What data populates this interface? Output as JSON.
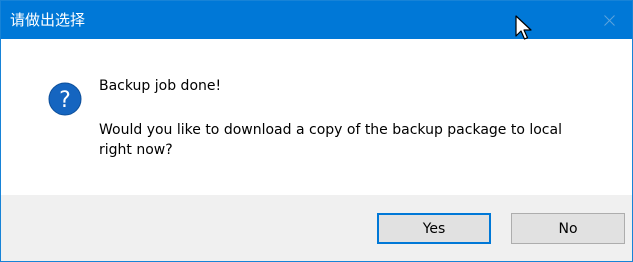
{
  "window": {
    "title": "请做出选择"
  },
  "message": {
    "heading": "Backup job done!",
    "body": "Would you like to download a copy of the backup package to local right now?"
  },
  "buttons": {
    "yes_label": "Yes",
    "no_label": "No"
  },
  "icons": {
    "dialog_icon": "question-icon",
    "close": "close-icon",
    "pointer": "mouse-cursor-icon"
  },
  "colors": {
    "titlebar": "#0078d7",
    "question_icon": "#1565c0",
    "footer": "#f0f0f0",
    "default_button_border": "#0078d7"
  }
}
